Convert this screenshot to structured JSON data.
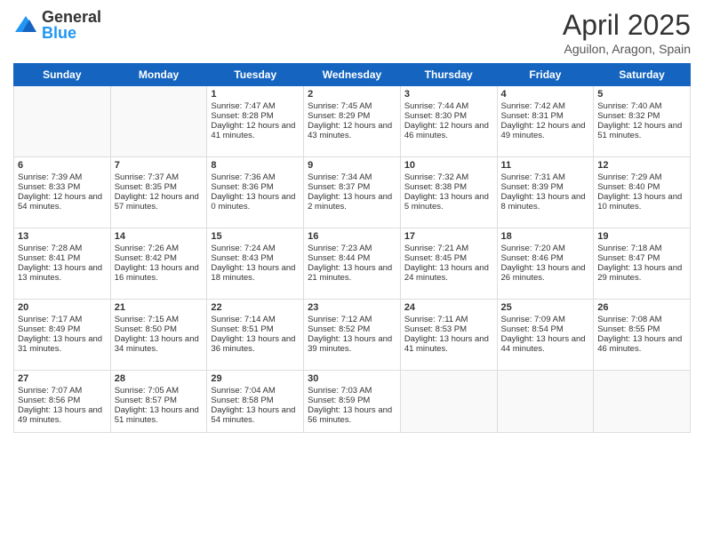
{
  "header": {
    "logo_general": "General",
    "logo_blue": "Blue",
    "title": "April 2025",
    "subtitle": "Aguilon, Aragon, Spain"
  },
  "days_of_week": [
    "Sunday",
    "Monday",
    "Tuesday",
    "Wednesday",
    "Thursday",
    "Friday",
    "Saturday"
  ],
  "weeks": [
    [
      {
        "day": null,
        "sunrise": null,
        "sunset": null,
        "daylight": null
      },
      {
        "day": null,
        "sunrise": null,
        "sunset": null,
        "daylight": null
      },
      {
        "day": "1",
        "sunrise": "Sunrise: 7:47 AM",
        "sunset": "Sunset: 8:28 PM",
        "daylight": "Daylight: 12 hours and 41 minutes."
      },
      {
        "day": "2",
        "sunrise": "Sunrise: 7:45 AM",
        "sunset": "Sunset: 8:29 PM",
        "daylight": "Daylight: 12 hours and 43 minutes."
      },
      {
        "day": "3",
        "sunrise": "Sunrise: 7:44 AM",
        "sunset": "Sunset: 8:30 PM",
        "daylight": "Daylight: 12 hours and 46 minutes."
      },
      {
        "day": "4",
        "sunrise": "Sunrise: 7:42 AM",
        "sunset": "Sunset: 8:31 PM",
        "daylight": "Daylight: 12 hours and 49 minutes."
      },
      {
        "day": "5",
        "sunrise": "Sunrise: 7:40 AM",
        "sunset": "Sunset: 8:32 PM",
        "daylight": "Daylight: 12 hours and 51 minutes."
      }
    ],
    [
      {
        "day": "6",
        "sunrise": "Sunrise: 7:39 AM",
        "sunset": "Sunset: 8:33 PM",
        "daylight": "Daylight: 12 hours and 54 minutes."
      },
      {
        "day": "7",
        "sunrise": "Sunrise: 7:37 AM",
        "sunset": "Sunset: 8:35 PM",
        "daylight": "Daylight: 12 hours and 57 minutes."
      },
      {
        "day": "8",
        "sunrise": "Sunrise: 7:36 AM",
        "sunset": "Sunset: 8:36 PM",
        "daylight": "Daylight: 13 hours and 0 minutes."
      },
      {
        "day": "9",
        "sunrise": "Sunrise: 7:34 AM",
        "sunset": "Sunset: 8:37 PM",
        "daylight": "Daylight: 13 hours and 2 minutes."
      },
      {
        "day": "10",
        "sunrise": "Sunrise: 7:32 AM",
        "sunset": "Sunset: 8:38 PM",
        "daylight": "Daylight: 13 hours and 5 minutes."
      },
      {
        "day": "11",
        "sunrise": "Sunrise: 7:31 AM",
        "sunset": "Sunset: 8:39 PM",
        "daylight": "Daylight: 13 hours and 8 minutes."
      },
      {
        "day": "12",
        "sunrise": "Sunrise: 7:29 AM",
        "sunset": "Sunset: 8:40 PM",
        "daylight": "Daylight: 13 hours and 10 minutes."
      }
    ],
    [
      {
        "day": "13",
        "sunrise": "Sunrise: 7:28 AM",
        "sunset": "Sunset: 8:41 PM",
        "daylight": "Daylight: 13 hours and 13 minutes."
      },
      {
        "day": "14",
        "sunrise": "Sunrise: 7:26 AM",
        "sunset": "Sunset: 8:42 PM",
        "daylight": "Daylight: 13 hours and 16 minutes."
      },
      {
        "day": "15",
        "sunrise": "Sunrise: 7:24 AM",
        "sunset": "Sunset: 8:43 PM",
        "daylight": "Daylight: 13 hours and 18 minutes."
      },
      {
        "day": "16",
        "sunrise": "Sunrise: 7:23 AM",
        "sunset": "Sunset: 8:44 PM",
        "daylight": "Daylight: 13 hours and 21 minutes."
      },
      {
        "day": "17",
        "sunrise": "Sunrise: 7:21 AM",
        "sunset": "Sunset: 8:45 PM",
        "daylight": "Daylight: 13 hours and 24 minutes."
      },
      {
        "day": "18",
        "sunrise": "Sunrise: 7:20 AM",
        "sunset": "Sunset: 8:46 PM",
        "daylight": "Daylight: 13 hours and 26 minutes."
      },
      {
        "day": "19",
        "sunrise": "Sunrise: 7:18 AM",
        "sunset": "Sunset: 8:47 PM",
        "daylight": "Daylight: 13 hours and 29 minutes."
      }
    ],
    [
      {
        "day": "20",
        "sunrise": "Sunrise: 7:17 AM",
        "sunset": "Sunset: 8:49 PM",
        "daylight": "Daylight: 13 hours and 31 minutes."
      },
      {
        "day": "21",
        "sunrise": "Sunrise: 7:15 AM",
        "sunset": "Sunset: 8:50 PM",
        "daylight": "Daylight: 13 hours and 34 minutes."
      },
      {
        "day": "22",
        "sunrise": "Sunrise: 7:14 AM",
        "sunset": "Sunset: 8:51 PM",
        "daylight": "Daylight: 13 hours and 36 minutes."
      },
      {
        "day": "23",
        "sunrise": "Sunrise: 7:12 AM",
        "sunset": "Sunset: 8:52 PM",
        "daylight": "Daylight: 13 hours and 39 minutes."
      },
      {
        "day": "24",
        "sunrise": "Sunrise: 7:11 AM",
        "sunset": "Sunset: 8:53 PM",
        "daylight": "Daylight: 13 hours and 41 minutes."
      },
      {
        "day": "25",
        "sunrise": "Sunrise: 7:09 AM",
        "sunset": "Sunset: 8:54 PM",
        "daylight": "Daylight: 13 hours and 44 minutes."
      },
      {
        "day": "26",
        "sunrise": "Sunrise: 7:08 AM",
        "sunset": "Sunset: 8:55 PM",
        "daylight": "Daylight: 13 hours and 46 minutes."
      }
    ],
    [
      {
        "day": "27",
        "sunrise": "Sunrise: 7:07 AM",
        "sunset": "Sunset: 8:56 PM",
        "daylight": "Daylight: 13 hours and 49 minutes."
      },
      {
        "day": "28",
        "sunrise": "Sunrise: 7:05 AM",
        "sunset": "Sunset: 8:57 PM",
        "daylight": "Daylight: 13 hours and 51 minutes."
      },
      {
        "day": "29",
        "sunrise": "Sunrise: 7:04 AM",
        "sunset": "Sunset: 8:58 PM",
        "daylight": "Daylight: 13 hours and 54 minutes."
      },
      {
        "day": "30",
        "sunrise": "Sunrise: 7:03 AM",
        "sunset": "Sunset: 8:59 PM",
        "daylight": "Daylight: 13 hours and 56 minutes."
      },
      {
        "day": null,
        "sunrise": null,
        "sunset": null,
        "daylight": null
      },
      {
        "day": null,
        "sunrise": null,
        "sunset": null,
        "daylight": null
      },
      {
        "day": null,
        "sunrise": null,
        "sunset": null,
        "daylight": null
      }
    ]
  ]
}
